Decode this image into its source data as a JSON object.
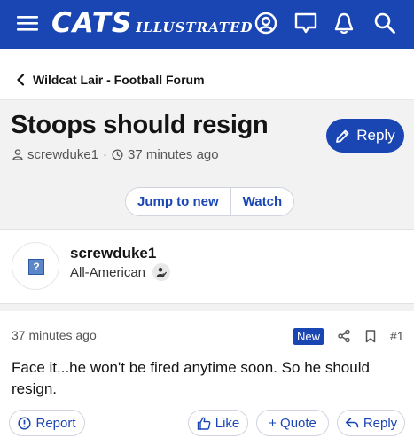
{
  "header": {
    "logo_main": "CATS",
    "logo_sub": "ILLUSTRATED",
    "icons": [
      "menu-icon",
      "account-icon",
      "messages-icon",
      "alerts-icon",
      "search-icon"
    ]
  },
  "breadcrumb": {
    "label": "Wildcat Lair - Football Forum"
  },
  "thread": {
    "title": "Stoops should resign",
    "author": "screwduke1",
    "separator": "·",
    "time": "37 minutes ago",
    "reply_label": "Reply",
    "jump_label": "Jump to new",
    "watch_label": "Watch"
  },
  "user": {
    "name": "screwduke1",
    "rank": "All-American",
    "avatar_glyph": "?"
  },
  "post": {
    "time": "37 minutes ago",
    "new_badge": "New",
    "number": "#1",
    "body": "Face it...he won't be fired anytime soon. So he should resign.",
    "report_label": "Report",
    "like_label": "Like",
    "quote_label": "+ Quote",
    "reply_label": "Reply"
  },
  "colors": {
    "brand_blue": "#1a46b4",
    "background_gray": "#f2f2f2"
  }
}
